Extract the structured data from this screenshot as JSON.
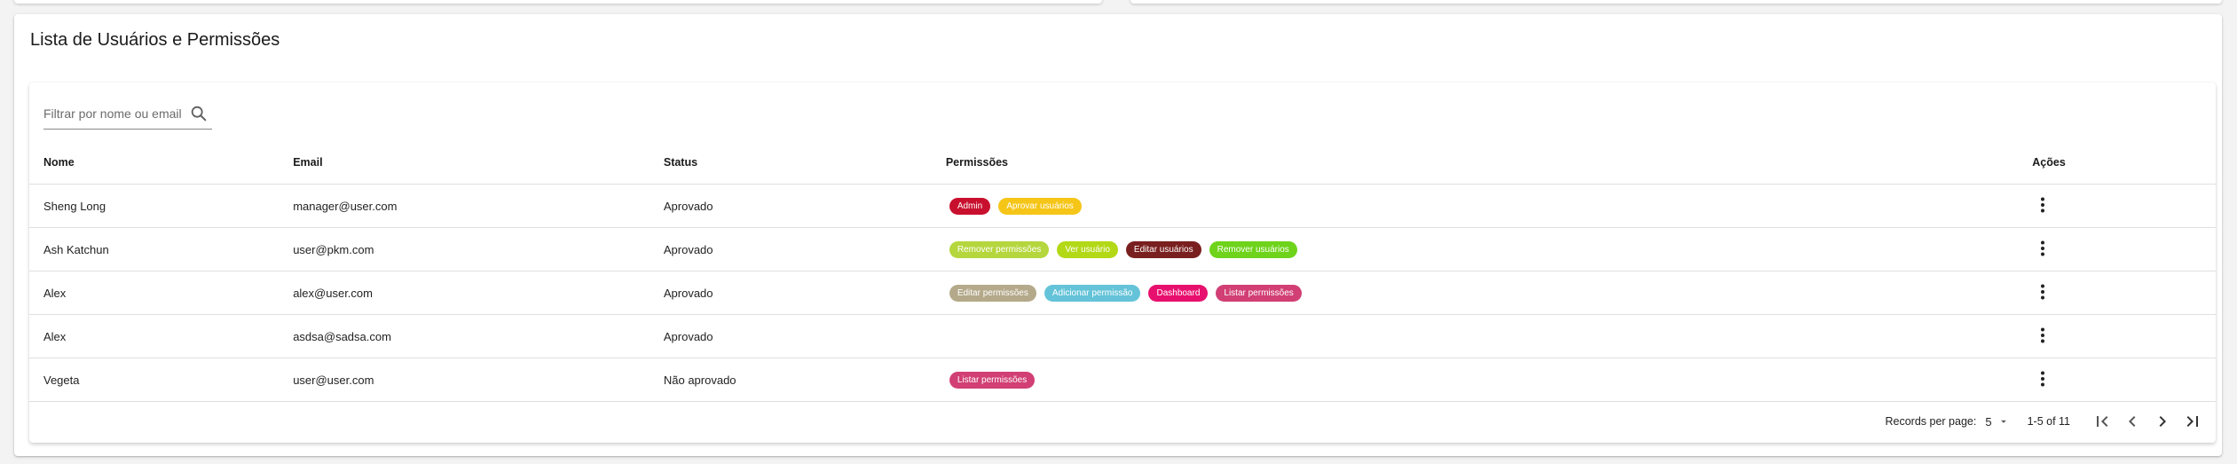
{
  "page": {
    "title": "Lista de Usuários e Permissões"
  },
  "filter": {
    "placeholder": "Filtrar por nome ou email",
    "icon": "search-icon"
  },
  "table": {
    "headers": {
      "name": "Nome",
      "email": "Email",
      "status": "Status",
      "permissions": "Permissões",
      "actions": "Ações"
    },
    "rows": [
      {
        "name": "Sheng Long",
        "email": "manager@user.com",
        "status": "Aprovado",
        "permissions": [
          {
            "label": "Admin",
            "color": "#c8102e"
          },
          {
            "label": "Aprovar usuários",
            "color": "#f5c518"
          }
        ]
      },
      {
        "name": "Ash Katchun",
        "email": "user@pkm.com",
        "status": "Aprovado",
        "permissions": [
          {
            "label": "Remover permissões",
            "color": "#b5d63d"
          },
          {
            "label": "Ver usuário",
            "color": "#b3d816"
          },
          {
            "label": "Editar usuários",
            "color": "#7a1f1f"
          },
          {
            "label": "Remover usuários",
            "color": "#6ed31a"
          }
        ]
      },
      {
        "name": "Alex",
        "email": "alex@user.com",
        "status": "Aprovado",
        "permissions": [
          {
            "label": "Editar permissões",
            "color": "#b4a98a"
          },
          {
            "label": "Adicionar permissão",
            "color": "#64c3d8"
          },
          {
            "label": "Dashboard",
            "color": "#e8106e"
          },
          {
            "label": "Listar permissões",
            "color": "#d13f74"
          }
        ]
      },
      {
        "name": "Alex",
        "email": "asdsa@sadsa.com",
        "status": "Aprovado",
        "permissions": []
      },
      {
        "name": "Vegeta",
        "email": "user@user.com",
        "status": "Não aprovado",
        "permissions": [
          {
            "label": "Listar permissões",
            "color": "#d13f74"
          }
        ]
      }
    ]
  },
  "pagination": {
    "rows_per_page_label": "Records per page:",
    "rows_per_page_value": "5",
    "range": "1-5 of 11"
  }
}
